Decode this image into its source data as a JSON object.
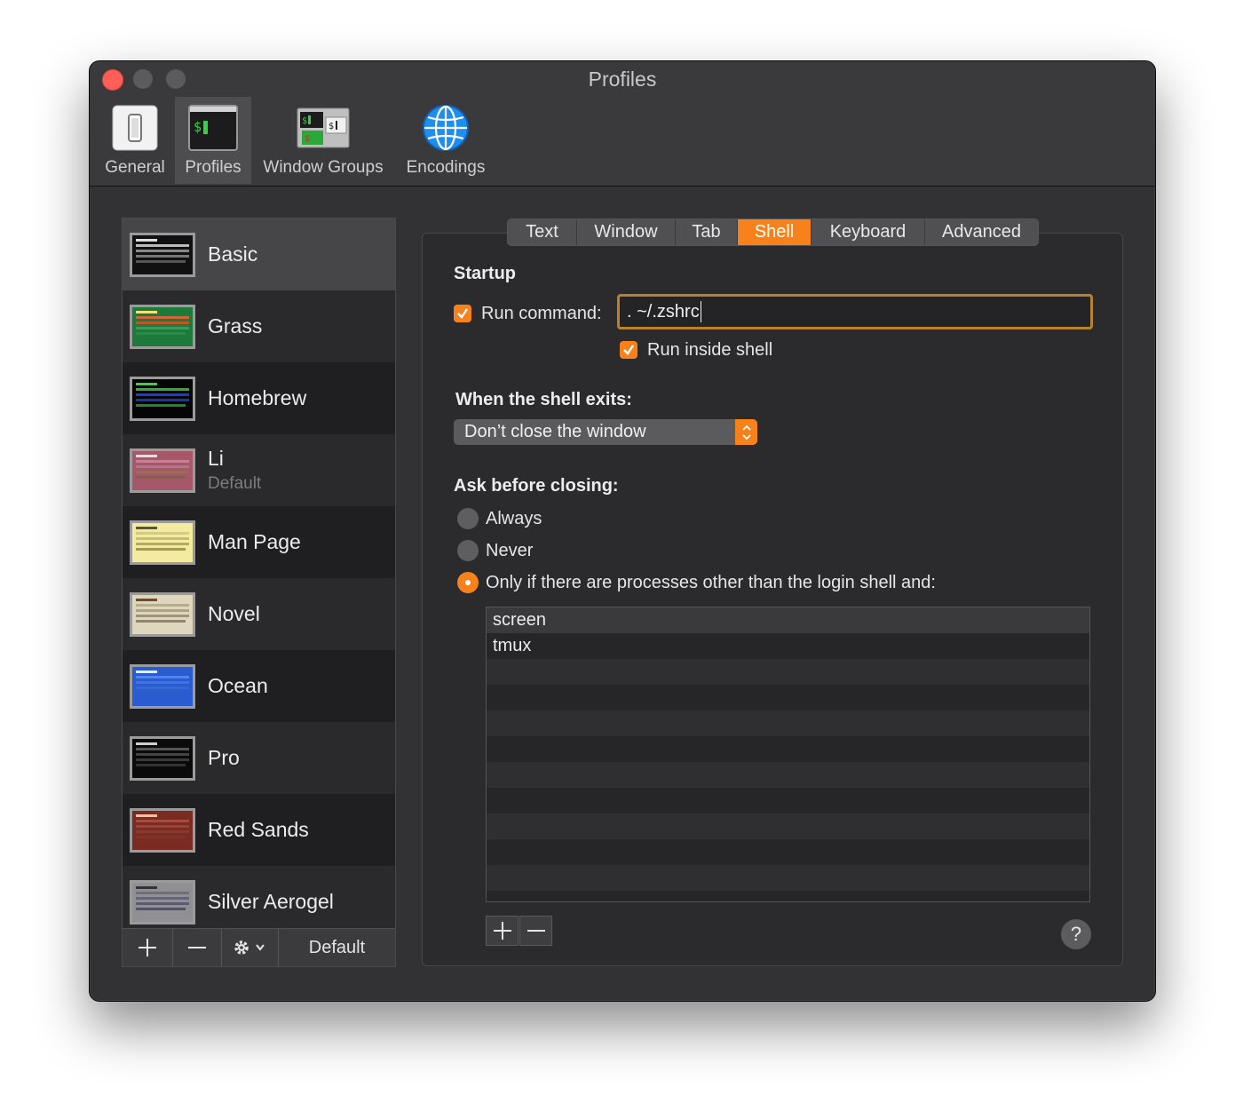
{
  "window": {
    "title": "Profiles"
  },
  "toolbar": {
    "items": [
      {
        "label": "General",
        "icon": "general-switch-icon"
      },
      {
        "label": "Profiles",
        "icon": "terminal-icon",
        "active": true
      },
      {
        "label": "Window Groups",
        "icon": "window-groups-icon"
      },
      {
        "label": "Encodings",
        "icon": "globe-icon"
      }
    ]
  },
  "sidebar": {
    "profiles": [
      {
        "name": "Basic",
        "subtitle": ""
      },
      {
        "name": "Grass",
        "subtitle": ""
      },
      {
        "name": "Homebrew",
        "subtitle": ""
      },
      {
        "name": "Li",
        "subtitle": "Default"
      },
      {
        "name": "Man Page",
        "subtitle": ""
      },
      {
        "name": "Novel",
        "subtitle": ""
      },
      {
        "name": "Ocean",
        "subtitle": ""
      },
      {
        "name": "Pro",
        "subtitle": ""
      },
      {
        "name": "Red Sands",
        "subtitle": ""
      },
      {
        "name": "Silver Aerogel",
        "subtitle": ""
      }
    ],
    "footer": {
      "add": "+",
      "remove": "—",
      "default_label": "Default"
    }
  },
  "tabs": [
    "Text",
    "Window",
    "Tab",
    "Shell",
    "Keyboard",
    "Advanced"
  ],
  "shell": {
    "startup_heading": "Startup",
    "run_command_label": "Run command:",
    "run_command_value": ". ~/.zshrc",
    "run_inside_shell_label": "Run inside shell",
    "exit_heading": "When the shell exits:",
    "exit_option": "Don’t close the window",
    "ask_heading": "Ask before closing:",
    "radio_always": "Always",
    "radio_never": "Never",
    "radio_only": "Only if there are processes other than the login shell and:",
    "processes": [
      "screen",
      "tmux"
    ],
    "help": "?"
  },
  "colors": {
    "accent": "#f7821b",
    "close": "#ff5f57"
  }
}
